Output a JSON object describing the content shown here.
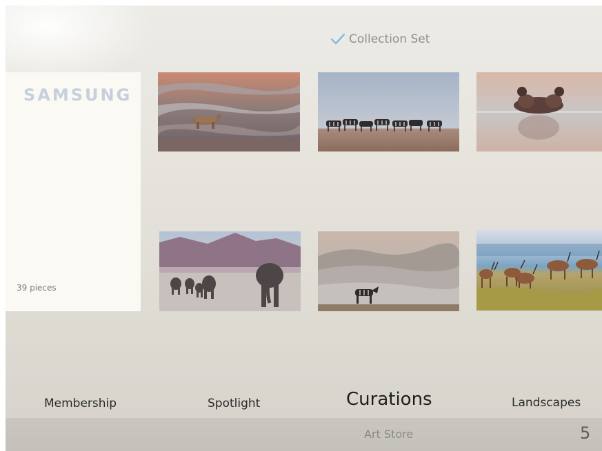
{
  "header": {
    "status_label": "Collection Set",
    "status_icon": "check-icon",
    "accent_color": "#7fbde0"
  },
  "collection": {
    "brand": "SAMSUNG",
    "pieces": "39 pieces"
  },
  "artworks": [
    {
      "subject": "rhino-crossing-water"
    },
    {
      "subject": "zebra-herd-on-horizon"
    },
    {
      "subject": "hippo-in-water"
    },
    {
      "subject": "elephant-family-walking"
    },
    {
      "subject": "zebra-in-misty-hills"
    },
    {
      "subject": "antelope-herd-by-lake"
    }
  ],
  "nav": {
    "membership": "Membership",
    "spotlight": "Spotlight",
    "curations": "Curations",
    "landscapes": "Landscapes",
    "active": "Curations"
  },
  "bottom_bar": {
    "title": "Art Store",
    "page_number": "5"
  }
}
